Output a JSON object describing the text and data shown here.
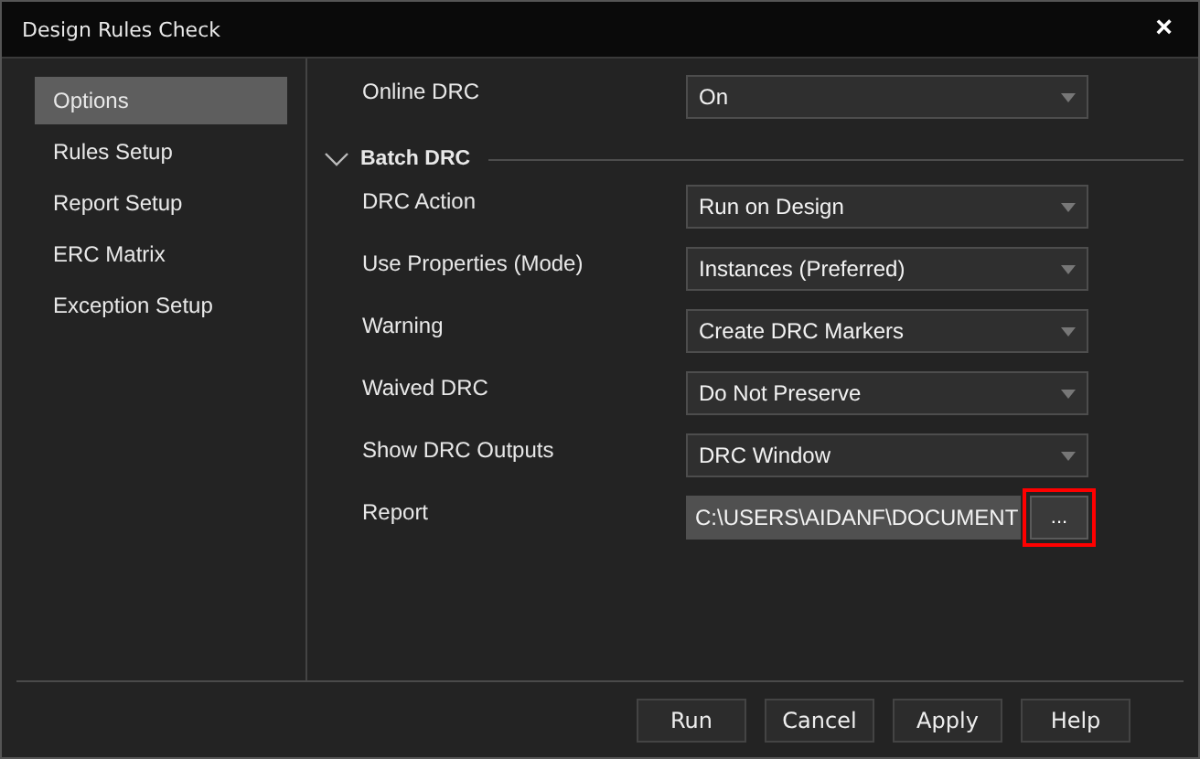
{
  "window": {
    "title": "Design Rules Check",
    "close": "×"
  },
  "sidebar": {
    "items": [
      {
        "label": "Options",
        "selected": true
      },
      {
        "label": "Rules Setup",
        "selected": false
      },
      {
        "label": "Report Setup",
        "selected": false
      },
      {
        "label": "ERC Matrix",
        "selected": false
      },
      {
        "label": "Exception Setup",
        "selected": false
      }
    ]
  },
  "online": {
    "label": "Online DRC",
    "value": "On"
  },
  "batch": {
    "title": "Batch DRC",
    "expanded": true,
    "rows": [
      {
        "kind": "dropdown",
        "label": "DRC Action",
        "value": "Run on Design"
      },
      {
        "kind": "dropdown",
        "label": "Use Properties (Mode)",
        "value": "Instances (Preferred)"
      },
      {
        "kind": "dropdown",
        "label": "Warning",
        "value": "Create DRC Markers"
      },
      {
        "kind": "dropdown",
        "label": "Waived DRC",
        "value": "Do Not Preserve"
      },
      {
        "kind": "dropdown",
        "label": "Show DRC Outputs",
        "value": "DRC Window"
      },
      {
        "kind": "path",
        "label": "Report",
        "value": "C:\\USERS\\AIDANF\\DOCUMENT",
        "browse": "...",
        "highlighted": true
      }
    ]
  },
  "buttons": [
    "Run",
    "Cancel",
    "Apply",
    "Help"
  ]
}
